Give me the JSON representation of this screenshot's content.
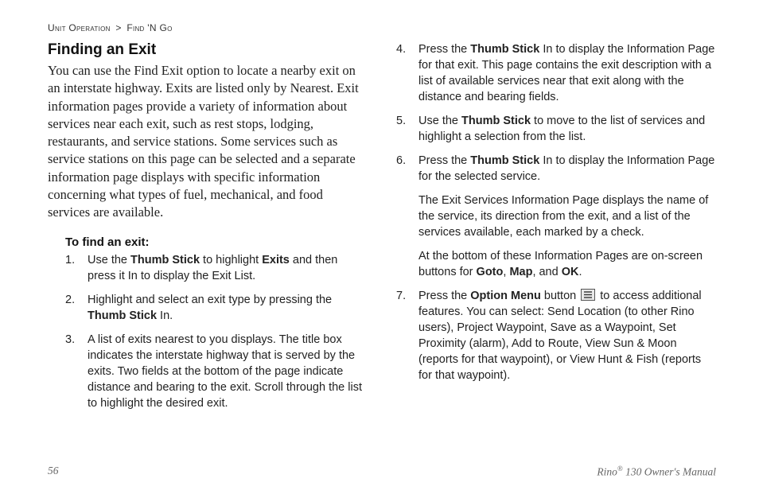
{
  "breadcrumb": {
    "section": "Unit Operation",
    "sep": ">",
    "subsection": "Find 'N Go"
  },
  "heading": "Finding an Exit",
  "intro": "You can use the Find Exit option to locate a nearby exit on an interstate highway. Exits are listed only by Nearest. Exit information pages provide a variety of information about services near each exit, such as rest stops, lodging, restaurants, and service stations. Some services such as service stations on this page can be selected and a separate information page displays with specific information concerning what types of fuel, mechanical, and food services are available.",
  "subhead": "To find an exit:",
  "steps_left": [
    {
      "pre": "Use the ",
      "b1": "Thumb Stick",
      "mid": " to highlight ",
      "b2": "Exits",
      "post": " and then press it In to display the Exit List."
    },
    {
      "pre": "Highlight and select an exit type by pressing the ",
      "b1": "Thumb Stick",
      "mid": "",
      "b2": "",
      "post": " In."
    },
    {
      "pre": "A list of exits nearest to you displays. The title box indicates the interstate highway that is served by the exits. Two fields at the bottom of the page indicate distance and bearing to the exit. Scroll through the list to highlight the desired exit.",
      "b1": "",
      "mid": "",
      "b2": "",
      "post": ""
    }
  ],
  "steps_right": [
    {
      "n": "4",
      "pre": "Press the ",
      "b1": "Thumb Stick",
      "post": " In to display the Information Page for that exit. This page contains the exit description with a list of available services near that exit along with the distance and bearing fields."
    },
    {
      "n": "5",
      "pre": "Use the ",
      "b1": "Thumb Stick",
      "post": " to move to the list of services and highlight a selection from the list."
    },
    {
      "n": "6",
      "pre": "Press the ",
      "b1": "Thumb Stick",
      "post": " In to display the Information Page for the selected service."
    }
  ],
  "extra6a": "The Exit Services Information Page displays the name of the service, its direction from the exit, and a list of the services available, each marked by a check.",
  "extra6b_pre": "At the bottom of these Information Pages are on-screen buttons for ",
  "extra6b_b1": "Goto",
  "extra6b_mid1": ", ",
  "extra6b_b2": "Map",
  "extra6b_mid2": ", and ",
  "extra6b_b3": "OK",
  "extra6b_post": ".",
  "step7_pre": "Press the ",
  "step7_b1": "Option Menu",
  "step7_mid": " button ",
  "step7_post": " to access additional features. You can select: Send Location (to other Rino users), Project Waypoint, Save as a Waypoint, Set Proximity (alarm), Add to Route, View Sun & Moon (reports for that waypoint), or View Hunt & Fish (reports for that waypoint).",
  "footer": {
    "page": "56",
    "brand": "Rino",
    "reg": "®",
    "model_suffix": " 130 Owner's Manual"
  }
}
